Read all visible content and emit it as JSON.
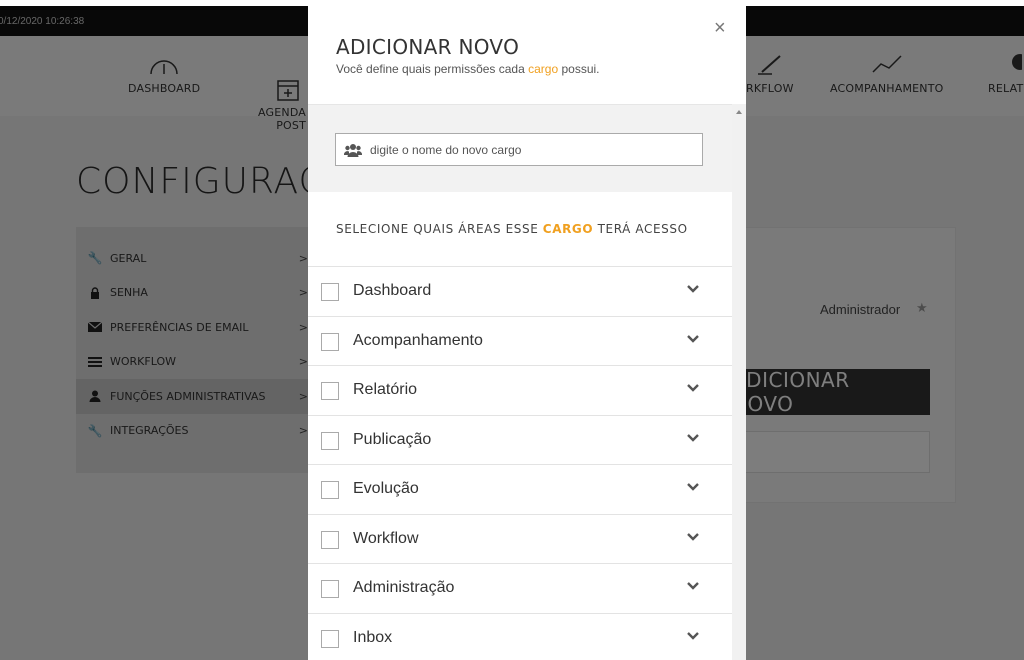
{
  "topbar": {
    "datetime": "0/12/2020 10:26:38"
  },
  "nav": {
    "items": [
      {
        "label": "DASHBOARD",
        "icon": "gauge-icon"
      },
      {
        "label": "AGENDA\nPOST",
        "icon": "calendar-plus-icon"
      },
      {
        "label": "RKFLOW",
        "icon": "pencil-icon"
      },
      {
        "label": "ACOMPANHAMENTO",
        "icon": "line-chart-icon"
      },
      {
        "label": "RELAT",
        "icon": "report-icon"
      }
    ]
  },
  "page": {
    "title": "CONFIGURAÇ"
  },
  "sidebar": {
    "items": [
      {
        "label": "GERAL",
        "icon": "wrench-icon"
      },
      {
        "label": "SENHA",
        "icon": "lock-icon"
      },
      {
        "label": "PREFERÊNCIAS DE EMAIL",
        "icon": "envelope-icon"
      },
      {
        "label": "WORKFLOW",
        "icon": "list-icon"
      },
      {
        "label": "FUNÇÕES ADMINISTRATIVAS",
        "icon": "user-icon"
      },
      {
        "label": "INTEGRAÇÕES",
        "icon": "wrench-icon"
      }
    ]
  },
  "panel": {
    "role_label": "Administrador",
    "add_button": "ADICIONAR NOVO"
  },
  "modal": {
    "title": "ADICIONAR NOVO",
    "subtitle_before": "Você define quais permissões cada ",
    "subtitle_accent": "cargo",
    "subtitle_after": " possui.",
    "close_label": "×",
    "input_placeholder": "digite o nome do novo cargo",
    "areas_heading_before": "SELECIONE QUAIS ÁREAS ESSE ",
    "areas_heading_accent": "CARGO",
    "areas_heading_after": " TERÁ ACESSO",
    "areas": [
      {
        "label": "Dashboard",
        "checked": false
      },
      {
        "label": "Acompanhamento",
        "checked": false
      },
      {
        "label": "Relatório",
        "checked": false
      },
      {
        "label": "Publicação",
        "checked": false
      },
      {
        "label": "Evolução",
        "checked": false
      },
      {
        "label": "Workflow",
        "checked": false
      },
      {
        "label": "Administração",
        "checked": false
      },
      {
        "label": "Inbox",
        "checked": false
      }
    ]
  },
  "colors": {
    "accent": "#f0a020",
    "overlay": "rgba(0,0,0,0.5)"
  }
}
